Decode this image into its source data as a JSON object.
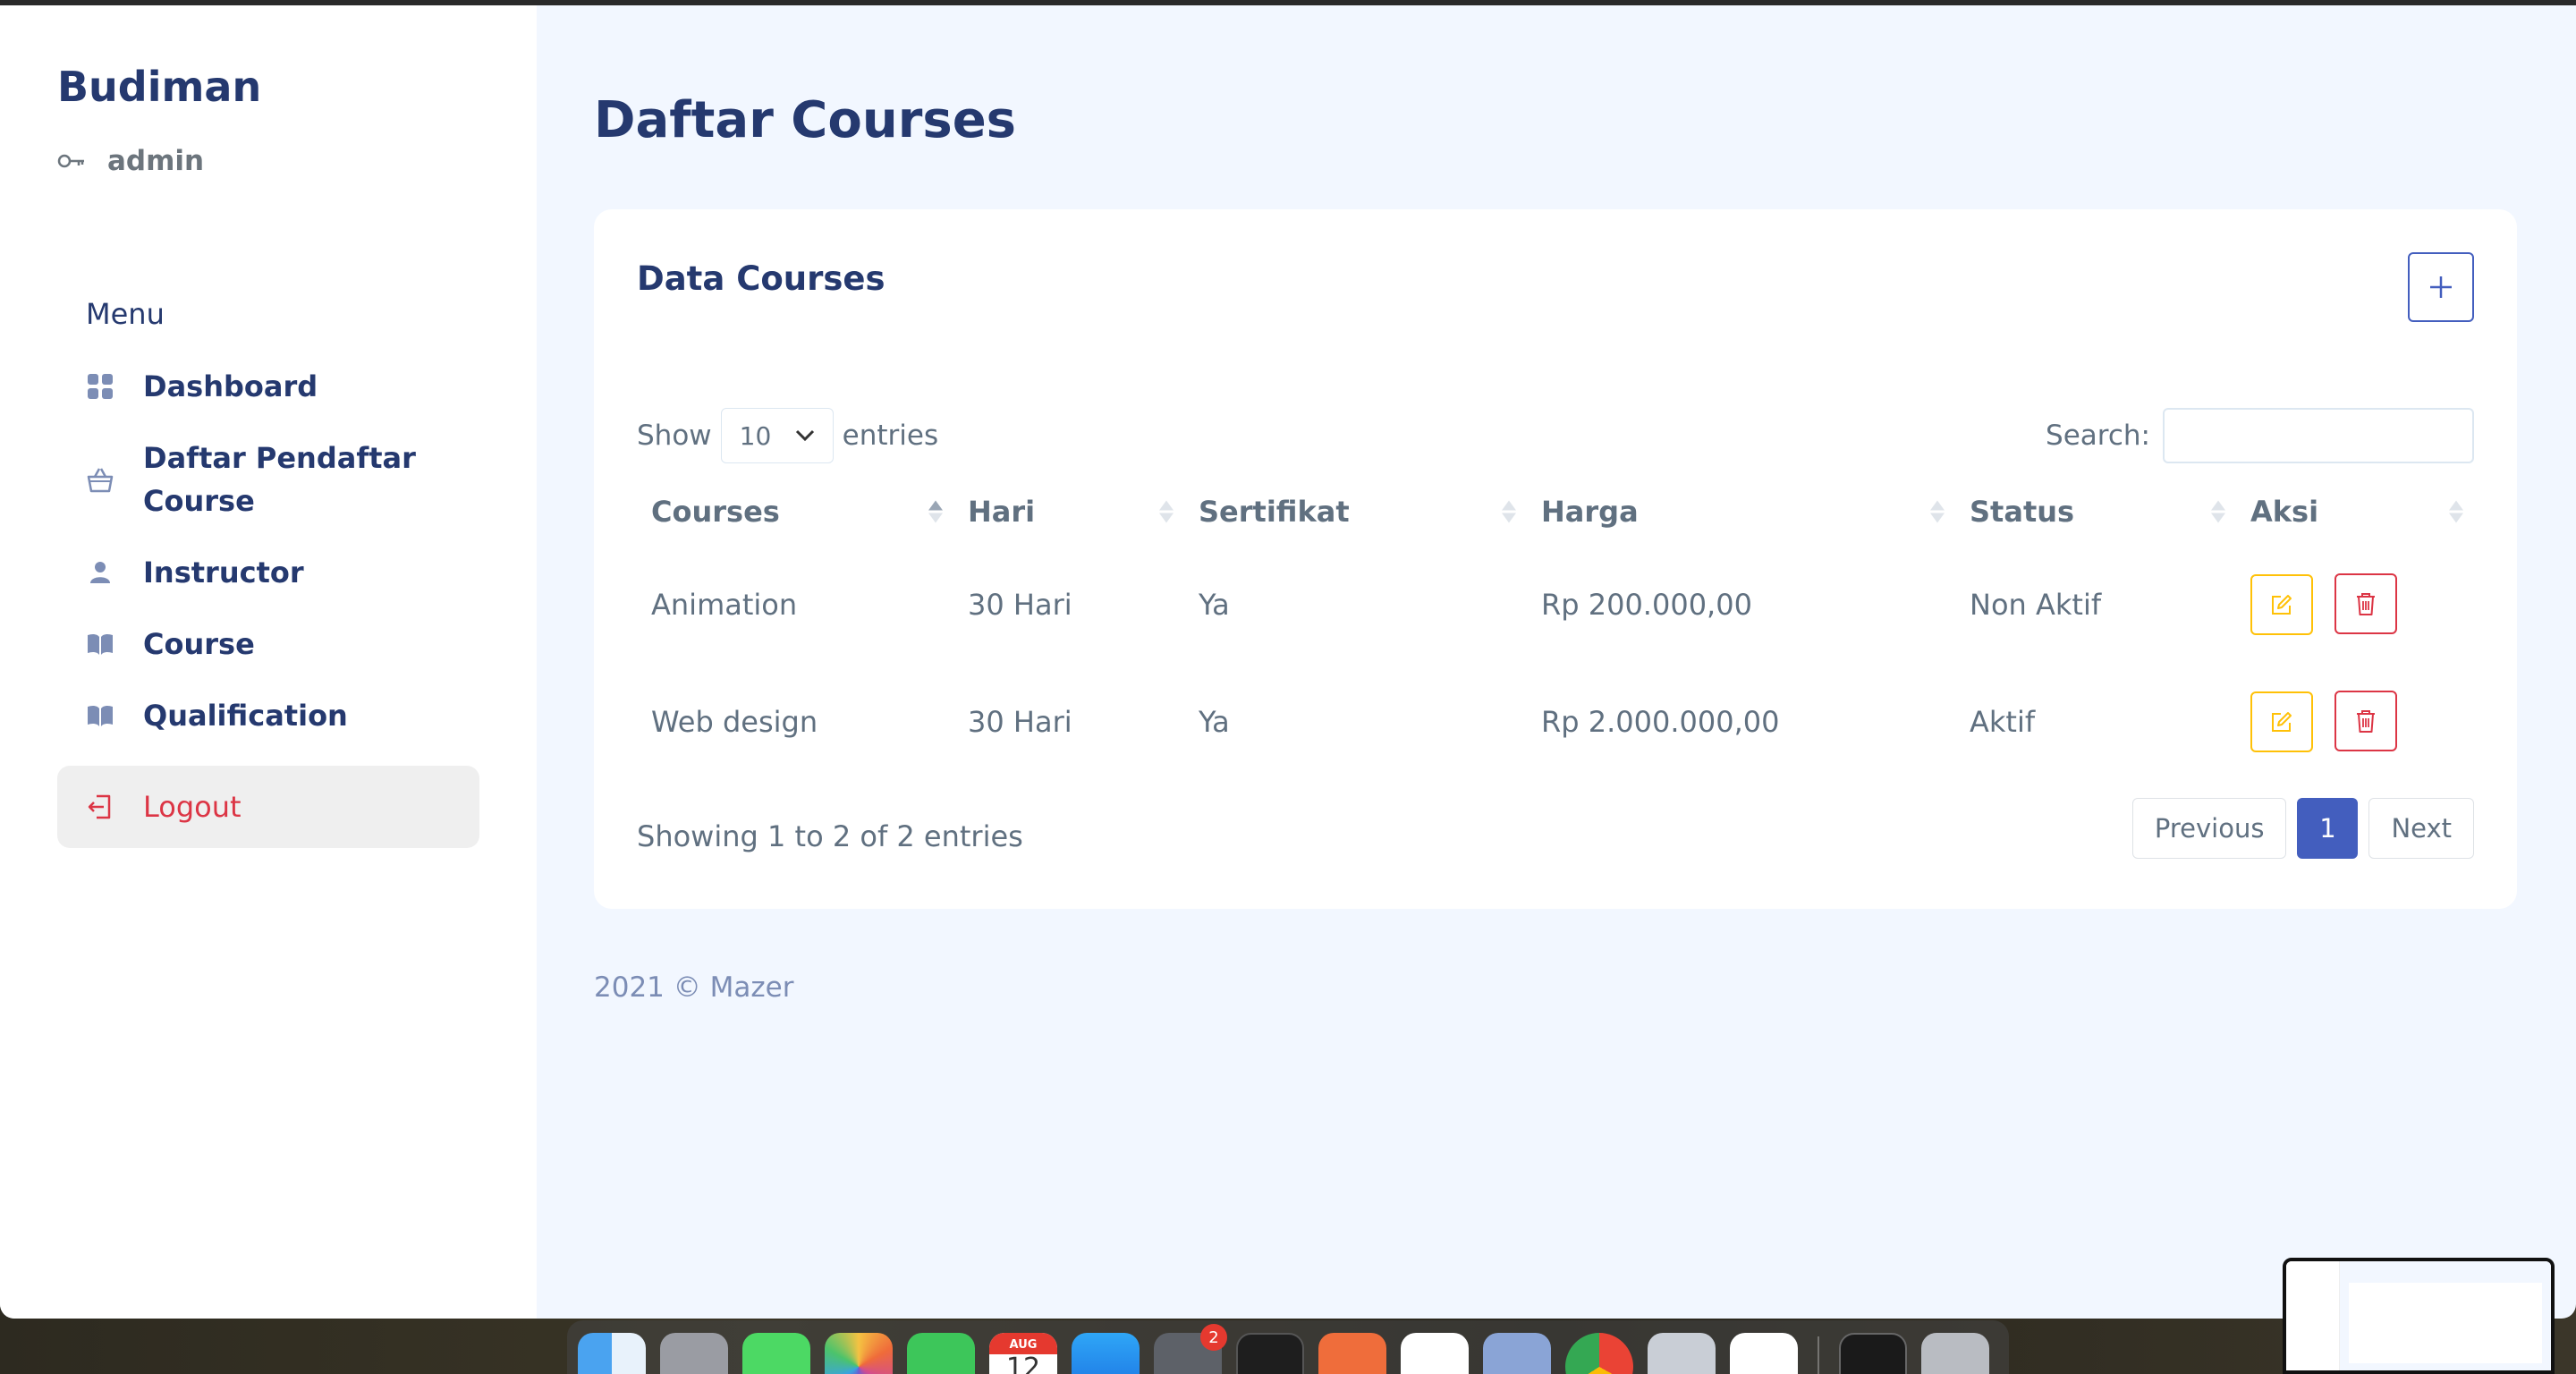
{
  "sidebar": {
    "brand": "Budiman",
    "role": "admin",
    "menu_title": "Menu",
    "items": [
      {
        "label": "Dashboard",
        "icon": "grid-icon"
      },
      {
        "label": "Daftar Pendaftar Course",
        "icon": "basket-icon"
      },
      {
        "label": "Instructor",
        "icon": "person-icon"
      },
      {
        "label": "Course",
        "icon": "book-icon"
      },
      {
        "label": "Qualification",
        "icon": "book-icon"
      }
    ],
    "logout": "Logout"
  },
  "main": {
    "page_title": "Daftar Courses",
    "card_title": "Data Courses",
    "length": {
      "prefix": "Show",
      "value": "10",
      "suffix": "entries"
    },
    "search": {
      "label": "Search:",
      "value": ""
    },
    "table": {
      "columns": [
        "Courses",
        "Hari",
        "Sertifikat",
        "Harga",
        "Status",
        "Aksi"
      ],
      "rows": [
        {
          "course": "Animation",
          "hari": "30 Hari",
          "sertifikat": "Ya",
          "harga": "Rp 200.000,00",
          "status": "Non Aktif"
        },
        {
          "course": "Web design",
          "hari": "30 Hari",
          "sertifikat": "Ya",
          "harga": "Rp 2.000.000,00",
          "status": "Aktif"
        }
      ]
    },
    "info": "Showing 1 to 2 of 2 entries",
    "pagination": {
      "previous": "Previous",
      "current": "1",
      "next": "Next"
    },
    "footer": "2021 © Mazer"
  },
  "dock": {
    "calendar_month": "AUG",
    "calendar_day": "12",
    "badge_count": "2"
  },
  "colors": {
    "primary": "#435ebe",
    "heading": "#25396f",
    "text": "#607080",
    "warning": "#ffc107",
    "danger": "#dc3545",
    "background": "#f2f7ff"
  }
}
